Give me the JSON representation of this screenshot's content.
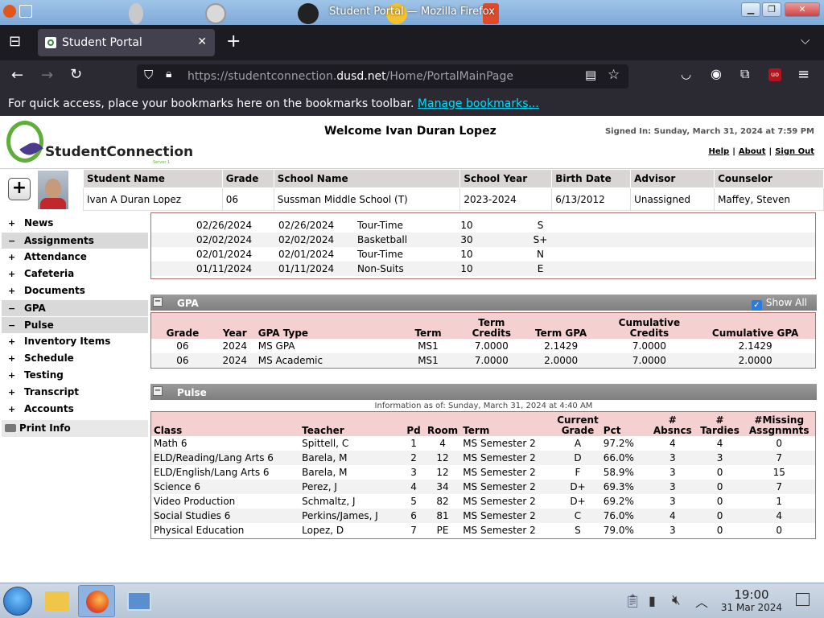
{
  "window": {
    "title": "Student Portal — Mozilla Firefox"
  },
  "browser": {
    "tab_title": "Student Portal",
    "url_dim": "https://studentconnection.",
    "url_domain": "dusd.net",
    "url_path": "/Home/PortalMainPage",
    "bookmarks_text": "For quick access, place your bookmarks here on the bookmarks toolbar.",
    "bookmarks_link": "Manage bookmarks..."
  },
  "header": {
    "logo": "StudentConnection",
    "logo_sub": "Server 1",
    "welcome": "Welcome Ivan Duran Lopez",
    "signed_in": "Signed In: Sunday, March 31, 2024 at 7:59 PM",
    "links": [
      "Help",
      "About",
      "Sign Out"
    ]
  },
  "student": {
    "headers": [
      "Student Name",
      "Grade",
      "School Name",
      "School Year",
      "Birth Date",
      "Advisor",
      "Counselor"
    ],
    "values": [
      "Ivan A Duran Lopez",
      "06",
      "Sussman Middle School (T)",
      "2023-2024",
      "6/13/2012",
      "Unassigned",
      "Maffey, Steven"
    ]
  },
  "sidebar": {
    "items": [
      {
        "sym": "+",
        "label": "News",
        "open": false
      },
      {
        "sym": "−",
        "label": "Assignments",
        "open": true
      },
      {
        "sym": "+",
        "label": "Attendance",
        "open": false
      },
      {
        "sym": "+",
        "label": "Cafeteria",
        "open": false
      },
      {
        "sym": "+",
        "label": "Documents",
        "open": false
      },
      {
        "sym": "−",
        "label": "GPA",
        "open": true
      },
      {
        "sym": "−",
        "label": "Pulse",
        "open": true
      },
      {
        "sym": "+",
        "label": "Inventory Items",
        "open": false
      },
      {
        "sym": "+",
        "label": "Schedule",
        "open": false
      },
      {
        "sym": "+",
        "label": "Testing",
        "open": false
      },
      {
        "sym": "+",
        "label": "Transcript",
        "open": false
      },
      {
        "sym": "+",
        "label": "Accounts",
        "open": false
      }
    ],
    "print_label": "Print Info"
  },
  "assignments_rows": [
    [
      "02/26/2024",
      "02/26/2024",
      "Tour-Time",
      "10",
      "S"
    ],
    [
      "02/02/2024",
      "02/02/2024",
      "Basketball",
      "30",
      "S+"
    ],
    [
      "02/01/2024",
      "02/01/2024",
      "Tour-Time",
      "10",
      "N"
    ],
    [
      "01/11/2024",
      "01/11/2024",
      "Non-Suits",
      "10",
      "E"
    ]
  ],
  "gpa": {
    "title": "GPA",
    "show_all": "Show All",
    "headers": [
      "Grade",
      "Year",
      "GPA Type",
      "Term",
      "Term Credits",
      "Term GPA",
      "Cumulative Credits",
      "Cumulative GPA"
    ],
    "rows": [
      [
        "06",
        "2024",
        "MS GPA",
        "MS1",
        "7.0000",
        "2.1429",
        "7.0000",
        "2.1429"
      ],
      [
        "06",
        "2024",
        "MS Academic",
        "MS1",
        "7.0000",
        "2.0000",
        "7.0000",
        "2.0000"
      ]
    ]
  },
  "pulse": {
    "title": "Pulse",
    "as_of": "Information as of: Sunday, March 31, 2024 at 4:40 AM",
    "headers": [
      "Class",
      "Teacher",
      "Pd",
      "Room",
      "Term",
      "Current Grade",
      "Pct",
      "# Absncs",
      "# Tardies",
      "#Missing Assgnmnts"
    ],
    "rows": [
      [
        "Math 6",
        "Spittell, C",
        "1",
        "4",
        "MS Semester 2",
        "A",
        "97.2%",
        "4",
        "4",
        "0"
      ],
      [
        "ELD/Reading/Lang Arts 6",
        "Barela, M",
        "2",
        "12",
        "MS Semester 2",
        "D",
        "66.0%",
        "3",
        "3",
        "7"
      ],
      [
        "ELD/English/Lang Arts 6",
        "Barela, M",
        "3",
        "12",
        "MS Semester 2",
        "F",
        "58.9%",
        "3",
        "0",
        "15"
      ],
      [
        "Science 6",
        "Perez, J",
        "4",
        "34",
        "MS Semester 2",
        "D+",
        "69.3%",
        "3",
        "0",
        "7"
      ],
      [
        "Video Production",
        "Schmaltz, J",
        "5",
        "82",
        "MS Semester 2",
        "D+",
        "69.2%",
        "3",
        "0",
        "1"
      ],
      [
        "Social Studies 6",
        "Perkins/James, J",
        "6",
        "81",
        "MS Semester 2",
        "C",
        "76.0%",
        "4",
        "0",
        "4"
      ],
      [
        "Physical Education",
        "Lopez, D",
        "7",
        "PE",
        "MS Semester 2",
        "S",
        "79.0%",
        "3",
        "0",
        "0"
      ]
    ]
  },
  "taskbar": {
    "time": "19:00",
    "date": "31 Mar 2024"
  }
}
